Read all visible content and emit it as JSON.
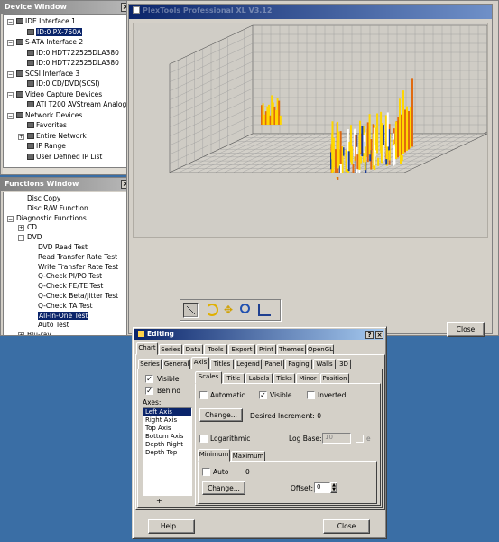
{
  "device_window": {
    "title": "Device Window",
    "items": [
      {
        "label": "IDE Interface 1",
        "level": 1,
        "expander": "−",
        "icon": "ide-icon"
      },
      {
        "label": "ID:0 PX-760A",
        "level": 2,
        "icon": "drive-icon",
        "selected": true
      },
      {
        "label": "S-ATA Interface 2",
        "level": 1,
        "expander": "−",
        "icon": "sata-icon"
      },
      {
        "label": "ID:0 HDT722525DLA380",
        "level": 2,
        "icon": "disk-icon"
      },
      {
        "label": "ID:0 HDT722525DLA380",
        "level": 2,
        "icon": "disk-icon"
      },
      {
        "label": "SCSI Interface 3",
        "level": 1,
        "expander": "−",
        "icon": "scsi-icon"
      },
      {
        "label": "ID:0 CD/DVD(SCSI)",
        "level": 2,
        "icon": "drive-icon"
      },
      {
        "label": "Video Capture Devices",
        "level": 1,
        "expander": "−",
        "icon": "video-icon"
      },
      {
        "label": "ATI T200 AVStream Analog",
        "level": 2,
        "icon": "video-icon"
      },
      {
        "label": "Network Devices",
        "level": 1,
        "expander": "−",
        "icon": "network-icon"
      },
      {
        "label": "Favorites",
        "level": 2,
        "icon": "network-icon"
      },
      {
        "label": "Entire Network",
        "level": 2,
        "expander": "+",
        "icon": "network-icon"
      },
      {
        "label": "IP Range",
        "level": 2,
        "icon": "network-icon"
      },
      {
        "label": "User Defined IP List",
        "level": 2,
        "icon": "network-icon"
      }
    ]
  },
  "functions_window": {
    "title": "Functions Window",
    "items": [
      {
        "label": "Disc Copy",
        "level": 2
      },
      {
        "label": "Disc R/W Function",
        "level": 2
      },
      {
        "label": "Diagnostic Functions",
        "level": 1,
        "expander": "−"
      },
      {
        "label": "CD",
        "level": 2,
        "expander": "+"
      },
      {
        "label": "DVD",
        "level": 2,
        "expander": "−"
      },
      {
        "label": "DVD Read Test",
        "level": 3
      },
      {
        "label": "Read Transfer Rate Test",
        "level": 3
      },
      {
        "label": "Write Transfer Rate Test",
        "level": 3
      },
      {
        "label": "Q-Check PI/PO Test",
        "level": 3
      },
      {
        "label": "Q-Check FE/TE Test",
        "level": 3
      },
      {
        "label": "Q-Check Beta/Jitter Test",
        "level": 3
      },
      {
        "label": "Q-Check TA Test",
        "level": 3
      },
      {
        "label": "All-In-One Test",
        "level": 3,
        "selected": true
      },
      {
        "label": "Auto Test",
        "level": 3
      },
      {
        "label": "Blu-ray",
        "level": 2,
        "expander": "+"
      }
    ]
  },
  "main_window": {
    "title": "PlexTools Professional XL V3.12",
    "close_label": "Close"
  },
  "editing": {
    "title": "Editing",
    "tabs_row1": [
      "Chart",
      "Series",
      "Data",
      "Tools",
      "Export",
      "Print",
      "Themes",
      "OpenGL"
    ],
    "tabs_row2": [
      "Series",
      "General",
      "Axis",
      "Titles",
      "Legend",
      "Panel",
      "Paging",
      "Walls",
      "3D"
    ],
    "left": {
      "visible_label": "Visible",
      "visible_checked": "✓",
      "behind_label": "Behind",
      "behind_checked": "✓",
      "axes_label": "Axes:",
      "axes": [
        "Left Axis",
        "Right Axis",
        "Top Axis",
        "Bottom Axis",
        "Depth Right",
        "Depth Top"
      ],
      "add_label": "+"
    },
    "sub_tabs": [
      "Scales",
      "Title",
      "Labels",
      "Ticks",
      "Minor",
      "Position"
    ],
    "scales": {
      "automatic_label": "Automatic",
      "visible_label": "Visible",
      "visible_checked": "✓",
      "inverted_label": "Inverted",
      "change_label": "Change...",
      "increment_label": "Desired Increment: 0",
      "logarithmic_label": "Logarithmic",
      "logbase_label": "Log Base:",
      "logbase_value": "10",
      "e_label": "e",
      "minmax_tabs": [
        "Minimum",
        "Maximum"
      ],
      "auto_label": "Auto",
      "auto_value": "0",
      "change2_label": "Change...",
      "offset_label": "Offset:",
      "offset_value": "0"
    },
    "help_label": "Help...",
    "close_label": "Close"
  },
  "colors": {
    "desktop": "#3a6ea5",
    "title_active": "#0a246a",
    "bar_yellow": "#ffd700",
    "bar_orange": "#e06a10",
    "bar_blue": "#1a3c9a"
  }
}
